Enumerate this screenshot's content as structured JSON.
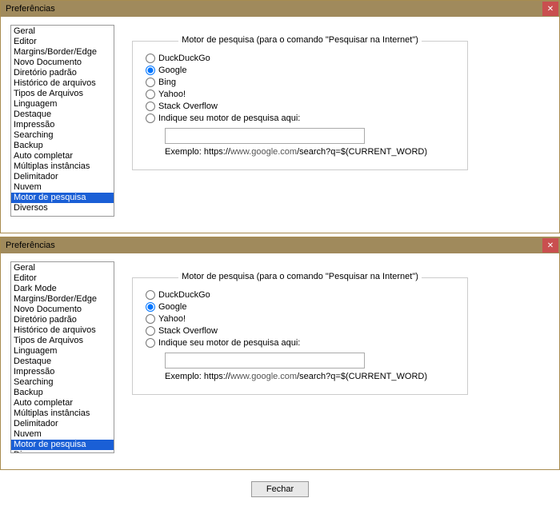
{
  "windows": [
    {
      "title": "Preferências",
      "sidebar_items": [
        "Geral",
        "Editor",
        "Margins/Border/Edge",
        "Novo Documento",
        "Diretório padrão",
        "Histórico de arquivos",
        "Tipos de Arquivos",
        "Linguagem",
        "Destaque",
        "Impressão",
        "Searching",
        "Backup",
        "Auto completar",
        "Múltiplas instâncias",
        "Delimitador",
        "Nuvem",
        "Motor de pesquisa",
        "Diversos"
      ],
      "selected_index": 16,
      "fieldset_legend": "Motor de pesquisa (para o comando \"Pesquisar na Internet\")",
      "radio_options": [
        "DuckDuckGo",
        "Google",
        "Bing",
        "Yahoo!",
        "Stack Overflow",
        "Indique seu motor de pesquisa aqui:"
      ],
      "radio_selected": 1,
      "custom_value": "",
      "example_prefix": "Exemplo: https://",
      "example_host": "www.google.com",
      "example_rest": "/search?q=$(CURRENT_WORD)"
    },
    {
      "title": "Preferências",
      "sidebar_items": [
        "Geral",
        "Editor",
        "Dark Mode",
        "Margins/Border/Edge",
        "Novo Documento",
        "Diretório padrão",
        "Histórico de arquivos",
        "Tipos de Arquivos",
        "Linguagem",
        "Destaque",
        "Impressão",
        "Searching",
        "Backup",
        "Auto completar",
        "Múltiplas instâncias",
        "Delimitador",
        "Nuvem",
        "Motor de pesquisa",
        "Diversos"
      ],
      "selected_index": 17,
      "fieldset_legend": "Motor de pesquisa (para o comando \"Pesquisar na Internet\")",
      "radio_options": [
        "DuckDuckGo",
        "Google",
        "Yahoo!",
        "Stack Overflow",
        "Indique seu motor de pesquisa aqui:"
      ],
      "radio_selected": 1,
      "custom_value": "",
      "example_prefix": "Exemplo: https://",
      "example_host": "www.google.com",
      "example_rest": "/search?q=$(CURRENT_WORD)"
    }
  ],
  "footer_button": "Fechar"
}
